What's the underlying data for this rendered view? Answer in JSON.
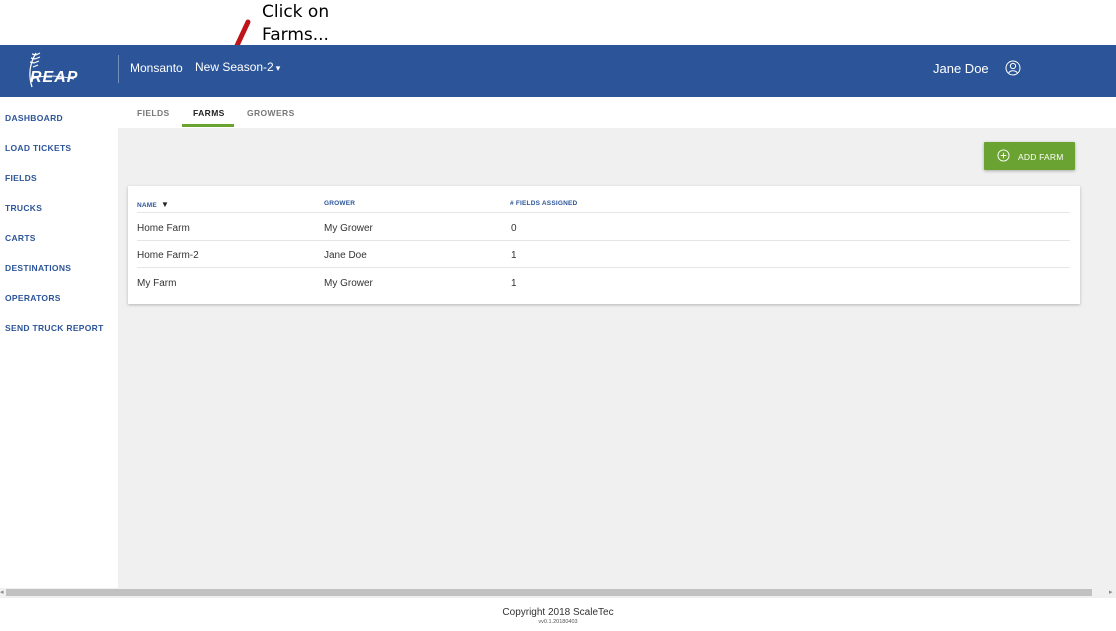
{
  "annotation": {
    "line1": "Click on",
    "line2": "Farms..."
  },
  "header": {
    "logo_text": "REAP",
    "organization": "Monsanto",
    "season": "New Season-2",
    "season_caret": "▾",
    "user_name": "Jane Doe"
  },
  "sidebar": {
    "items": [
      {
        "label": "DASHBOARD"
      },
      {
        "label": "LOAD TICKETS"
      },
      {
        "label": "FIELDS"
      },
      {
        "label": "TRUCKS"
      },
      {
        "label": "CARTS"
      },
      {
        "label": "DESTINATIONS"
      },
      {
        "label": "OPERATORS"
      },
      {
        "label": "SEND TRUCK REPORT"
      }
    ]
  },
  "tabs": [
    {
      "label": "FIELDS",
      "active": false
    },
    {
      "label": "FARMS",
      "active": true
    },
    {
      "label": "GROWERS",
      "active": false
    }
  ],
  "actions": {
    "add_farm_label": "ADD FARM"
  },
  "table": {
    "columns": [
      "NAME",
      "GROWER",
      "# FIELDS ASSIGNED"
    ],
    "sort_indicator": "▼",
    "rows": [
      {
        "name": "Home Farm",
        "grower": "My Grower",
        "fields_assigned": "0"
      },
      {
        "name": "Home Farm-2",
        "grower": "Jane Doe",
        "fields_assigned": "1"
      },
      {
        "name": "My Farm",
        "grower": "My Grower",
        "fields_assigned": "1"
      }
    ]
  },
  "footer": {
    "copyright": "Copyright 2018 ScaleTec",
    "version": "vv0.1.20180403"
  },
  "colors": {
    "brand_blue": "#2c5599",
    "accent_green": "#6aa332",
    "annotation_arrow": "#c0141b"
  }
}
